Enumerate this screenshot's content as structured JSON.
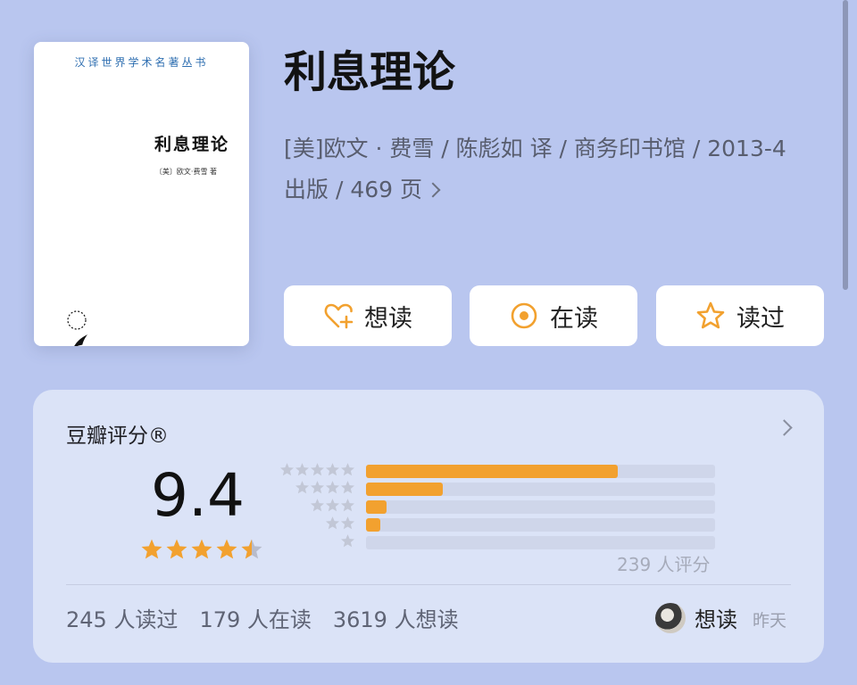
{
  "book": {
    "cover": {
      "series": "汉译世界学术名著丛书",
      "title": "利息理论",
      "author": "〔美〕欧文·费雪 著"
    },
    "title": "利息理论",
    "meta_line1": "[美]欧文 · 费雪 / 陈彪如 译 / 商务印书馆 / 2013-4",
    "meta_line2": "出版 / 469 页"
  },
  "actions": [
    {
      "label": "想读",
      "icon": "heart-plus-icon"
    },
    {
      "label": "在读",
      "icon": "target-circle-icon"
    },
    {
      "label": "读过",
      "icon": "star-outline-icon"
    }
  ],
  "rating": {
    "title": "豆瓣评分®",
    "score": "9.4",
    "star_value": 4.5,
    "distribution": [
      {
        "stars": 5,
        "fraction": 0.72
      },
      {
        "stars": 4,
        "fraction": 0.22
      },
      {
        "stars": 3,
        "fraction": 0.06
      },
      {
        "stars": 2,
        "fraction": 0.04
      },
      {
        "stars": 1,
        "fraction": 0.0
      }
    ],
    "count_text": "239 人评分"
  },
  "stats": {
    "read": "245 人读过",
    "reading": "179 人在读",
    "want": "3619 人想读"
  },
  "activity": {
    "action": "想读",
    "time": "昨天"
  },
  "colors": {
    "background": "#b9c6ef",
    "card": "#dbe3f7",
    "accent": "#f2a12f",
    "bar_track": "#cfd6ea"
  }
}
